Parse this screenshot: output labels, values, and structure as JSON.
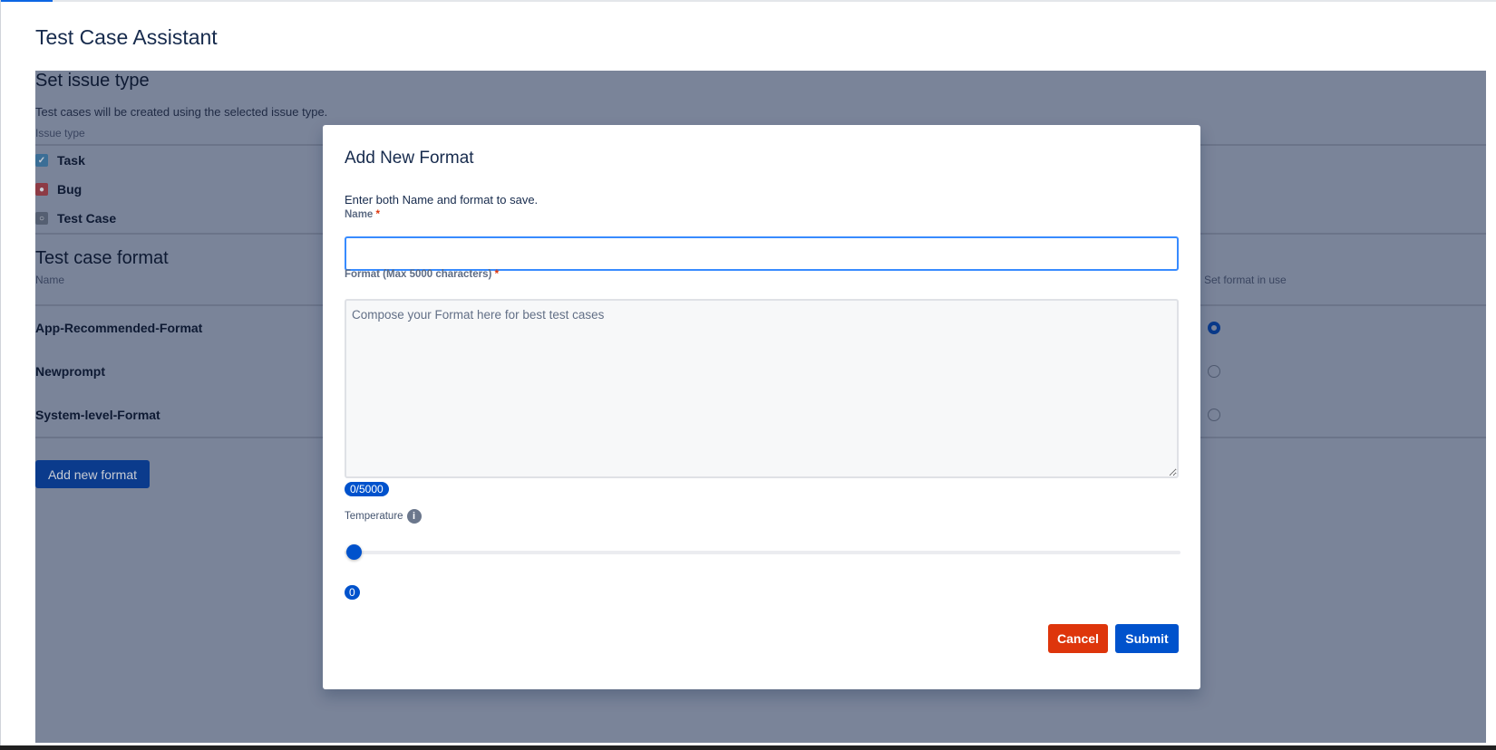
{
  "app_title": "Test Case Assistant",
  "issue_section": {
    "title": "Set issue type",
    "description": "Test cases will be created using the selected issue type.",
    "column_label": "Issue type",
    "items": [
      {
        "label": "Task",
        "icon": "task-icon",
        "color": "#4bade8"
      },
      {
        "label": "Bug",
        "icon": "bug-icon",
        "color": "#e5493a"
      },
      {
        "label": "Test Case",
        "icon": "test-case-icon",
        "color": "#8993a4"
      }
    ]
  },
  "format_section": {
    "title": "Test case format",
    "name_column": "Name",
    "in_use_column": "Set format in use",
    "rows": [
      {
        "name": "App-Recommended-Format",
        "selected": true
      },
      {
        "name": "Newprompt",
        "selected": false
      },
      {
        "name": "System-level-Format",
        "selected": false
      }
    ],
    "add_button": "Add new format"
  },
  "modal": {
    "title": "Add New Format",
    "description": "Enter both Name and format to save.",
    "name_label": "Name",
    "name_value": "",
    "format_label": "Format (Max 5000 characters)",
    "format_placeholder": "Compose your Format here for best test cases",
    "char_count": "0/5000",
    "temperature_label": "Temperature",
    "temperature_value": "0",
    "required_mark": "*",
    "cancel": "Cancel",
    "submit": "Submit",
    "colors": {
      "primary": "#0052cc",
      "danger": "#de350b"
    }
  }
}
